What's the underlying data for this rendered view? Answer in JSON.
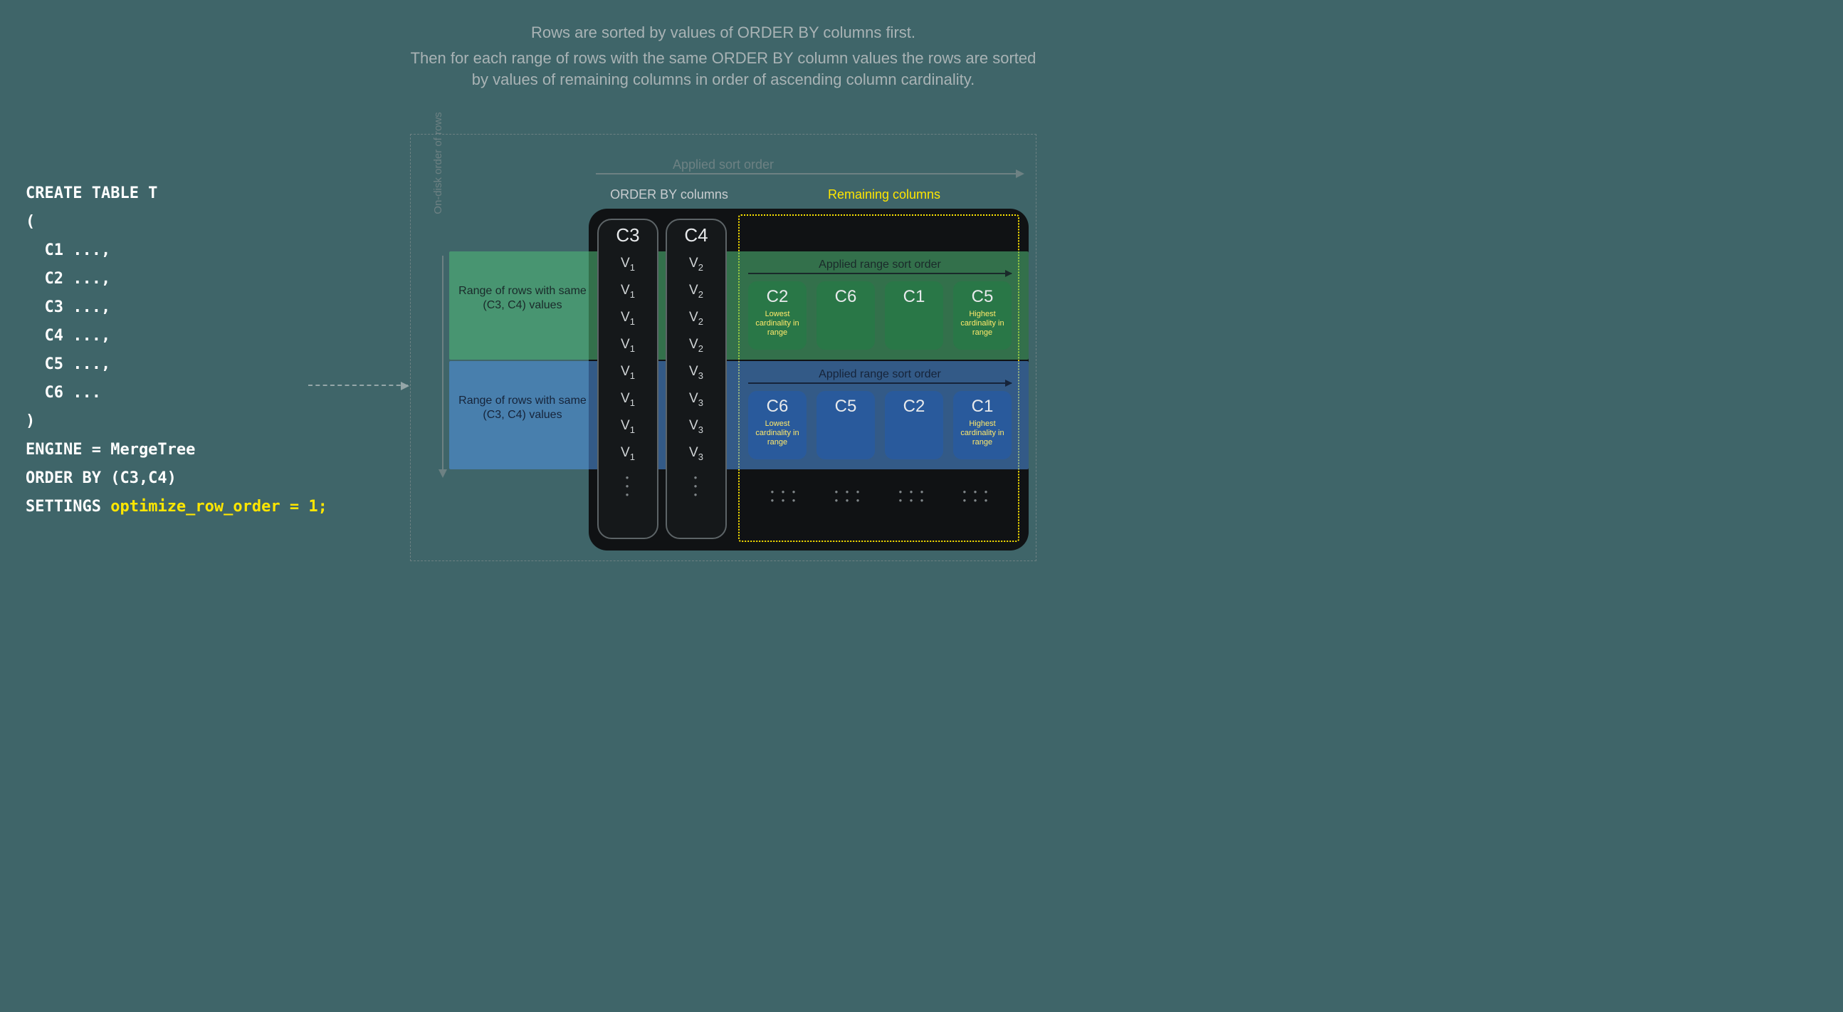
{
  "code": {
    "l1": "CREATE TABLE T",
    "l2": "(",
    "l3": "  C1 ...,",
    "l4": "  C2 ...,",
    "l5": "  C3 ...,",
    "l6": "  C4 ...,",
    "l7": "  C5 ...,",
    "l8": "  C6 ...",
    "l9": ")",
    "l10": "ENGINE = MergeTree",
    "l11": "ORDER BY (C3,C4)",
    "l12a": "SETTINGS ",
    "l12b": "optimize_row_order = 1;"
  },
  "desc": {
    "p1": "Rows are sorted by values of ORDER BY columns first.",
    "p2": "Then for each range of rows with the same ORDER BY column values the rows are sorted by values of remaining columns in order of ascending column cardinality."
  },
  "labels": {
    "applied": "Applied sort order",
    "orderby": "ORDER BY columns",
    "remaining": "Remaining columns",
    "ondisk": "On-disk order of rows",
    "range": "Range of rows with same (C3, C4) values",
    "rangeSort": "Applied range sort order",
    "lowest": "Lowest cardinality in range",
    "highest": "Highest cardinality in range"
  },
  "cols": {
    "c3": "C3",
    "c4": "C4"
  },
  "cells": {
    "v1": "V",
    "s1": "1",
    "v2": "V",
    "s2": "2",
    "v3": "V",
    "s3": "3"
  },
  "green": {
    "c1": "C2",
    "c2": "C6",
    "c3": "C1",
    "c4": "C5"
  },
  "blue": {
    "c1": "C6",
    "c2": "C5",
    "c3": "C2",
    "c4": "C1"
  },
  "dots": "● ● ●"
}
